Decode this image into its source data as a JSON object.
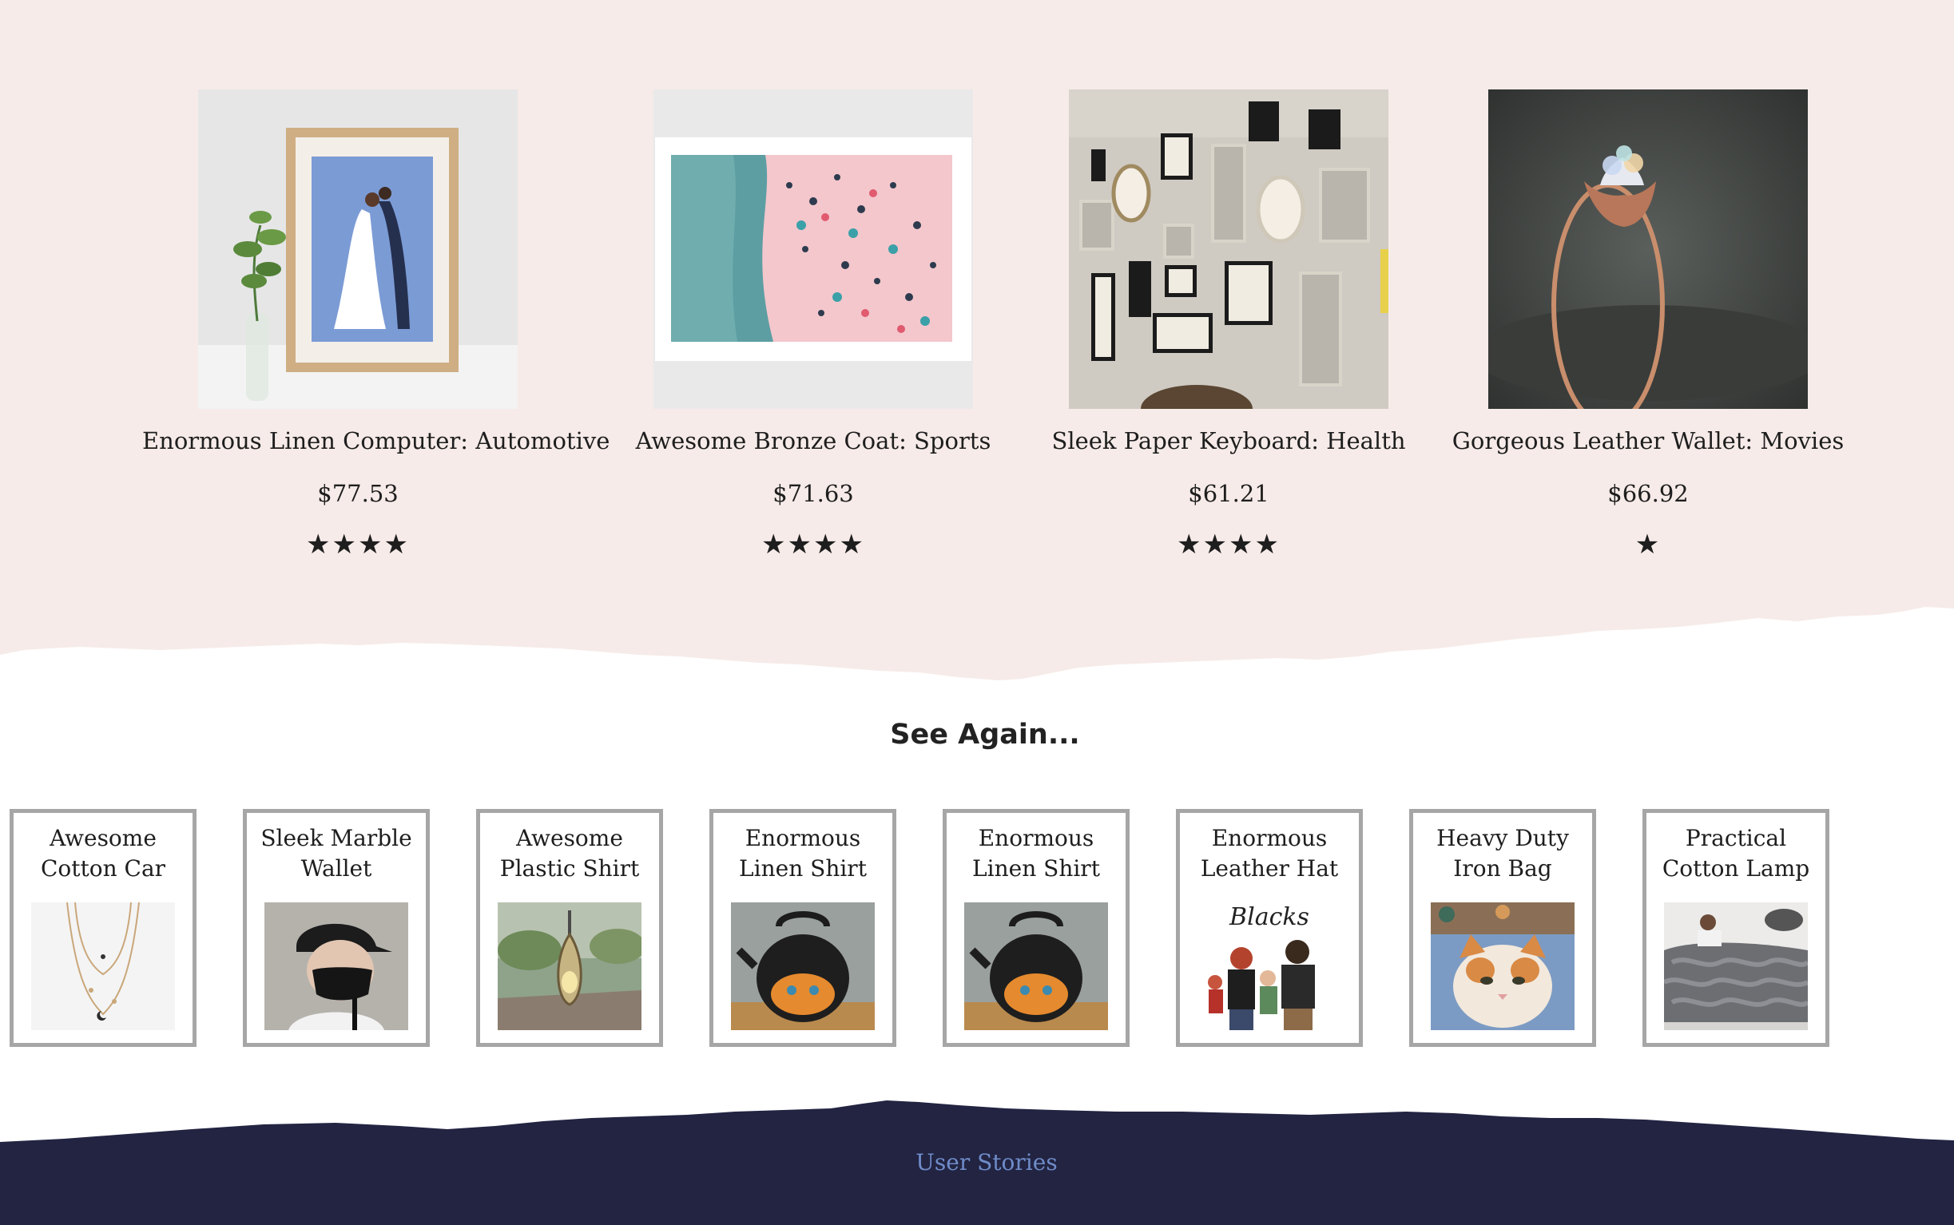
{
  "colors": {
    "section_background": "#f6ebe8",
    "footer_background": "#222442",
    "footer_link": "#6f8cc9",
    "card_border": "#a6a6a6",
    "text": "#1e1e1e"
  },
  "products": [
    {
      "name": "Enormous Linen Computer: Automotive",
      "price": "$77.53",
      "rating_stars": "★★★★",
      "rating": 4,
      "image": "framed-wedding-couple-illustration"
    },
    {
      "name": "Awesome Bronze Coat: Sports",
      "price": "$71.63",
      "rating_stars": "★★★★",
      "rating": 4,
      "image": "aerial-beach-print"
    },
    {
      "name": "Sleek Paper Keyboard: Health",
      "price": "$61.21",
      "rating_stars": "★★★★",
      "rating": 4,
      "image": "gallery-wall-frames"
    },
    {
      "name": "Gorgeous Leather Wallet: Movies",
      "price": "$66.92",
      "rating_stars": "★",
      "rating": 1,
      "image": "lotus-crystal-ring"
    }
  ],
  "see_again": {
    "title": "See Again...",
    "items": [
      {
        "name": "Awesome Cotton Car",
        "image": "layered-necklace"
      },
      {
        "name": "Sleek Marble Wallet",
        "image": "person-black-mask-cap"
      },
      {
        "name": "Awesome Plastic Shirt",
        "image": "pendant-on-rock"
      },
      {
        "name": "Enormous Linen Shirt",
        "image": "cat-painted-kettle"
      },
      {
        "name": "Enormous Linen Shirt",
        "image": "cat-painted-kettle"
      },
      {
        "name": "Enormous Leather Hat",
        "image": "family-portrait-illustration",
        "image_text": "Blacks"
      },
      {
        "name": "Heavy Duty Iron Bag",
        "image": "cat-print-blanket"
      },
      {
        "name": "Practical Cotton Lamp",
        "image": "chunky-knit-blanket"
      }
    ]
  },
  "footer": {
    "link_label": "User Stories"
  }
}
